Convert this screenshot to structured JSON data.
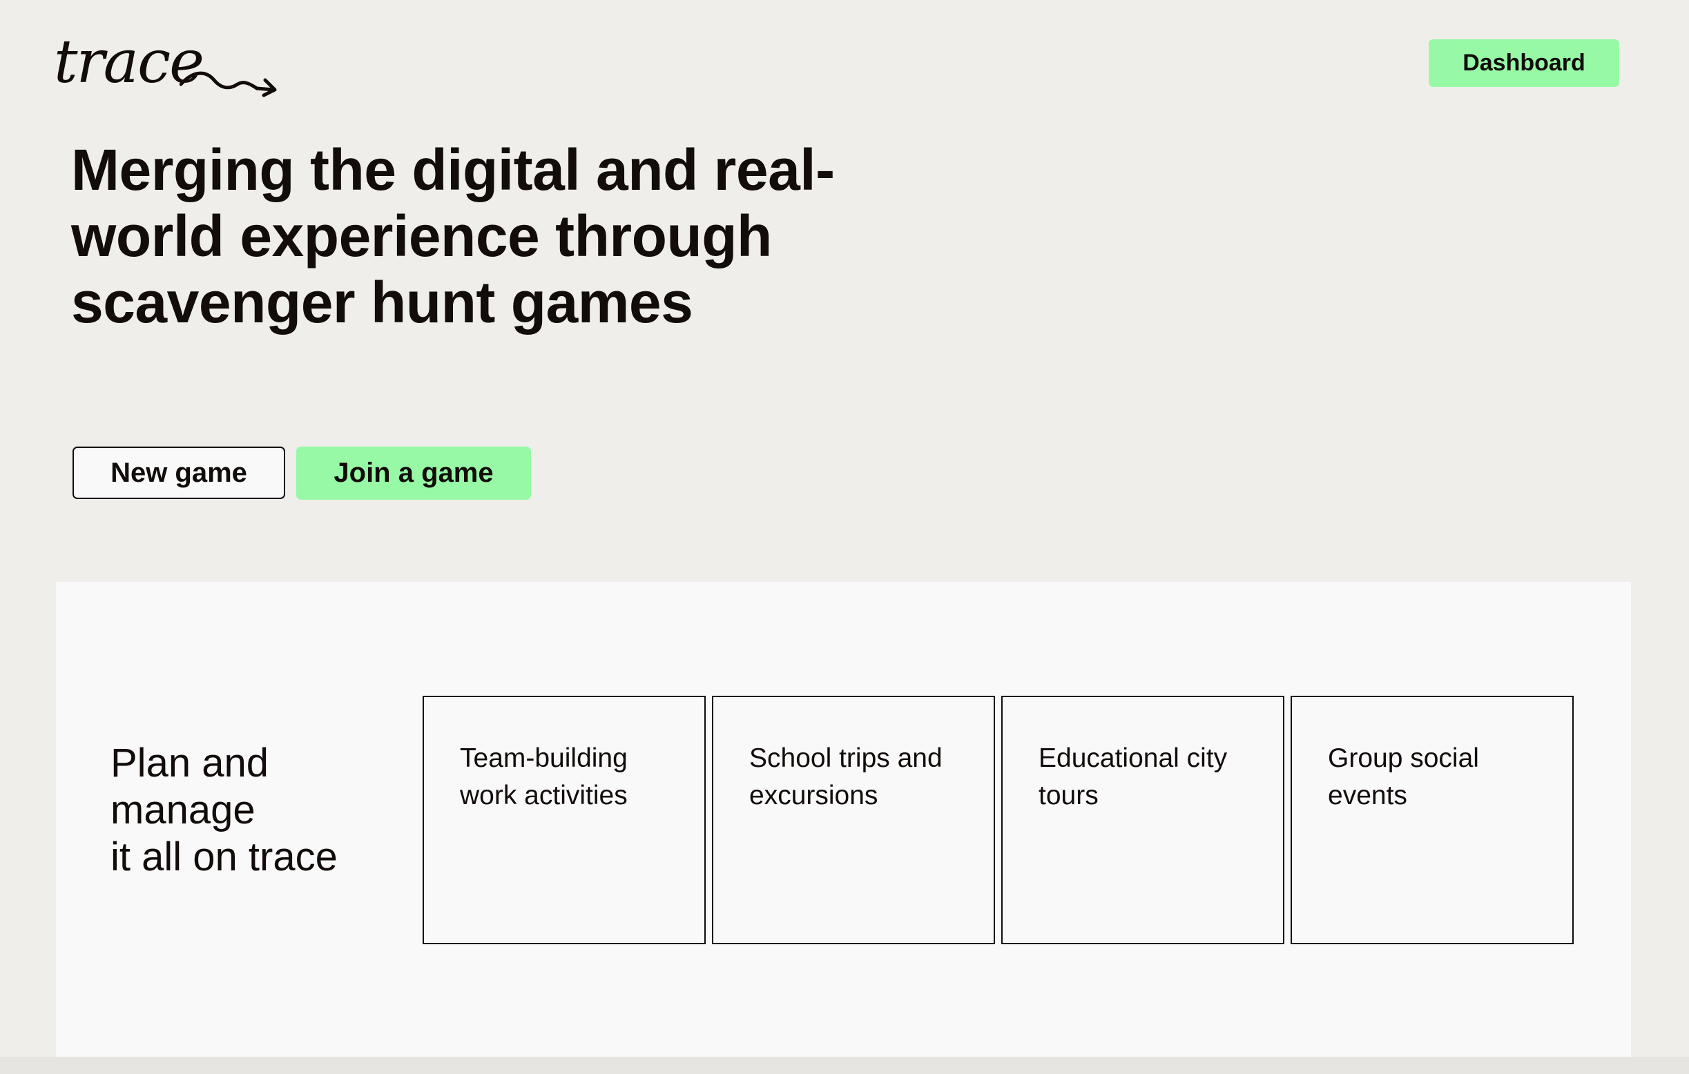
{
  "header": {
    "logo_text": "trace",
    "dashboard_label": "Dashboard"
  },
  "hero": {
    "title": "Merging the digital and real-world experience through scavenger hunt games",
    "new_game_label": "New game",
    "join_game_label": "Join a game"
  },
  "features": {
    "heading_lines": [
      "Plan and",
      "manage",
      "it all on trace"
    ],
    "cards": [
      {
        "lines": [
          "Team-building",
          "work activities"
        ]
      },
      {
        "lines": [
          "School trips and",
          "excursions"
        ]
      },
      {
        "lines": [
          "Educational city",
          "tours"
        ]
      },
      {
        "lines": [
          "Group social",
          "events"
        ]
      }
    ]
  },
  "colors": {
    "background": "#efeeea",
    "panel": "#f9f9fa",
    "accent_green": "#97f9a6",
    "text": "#120c0a"
  }
}
